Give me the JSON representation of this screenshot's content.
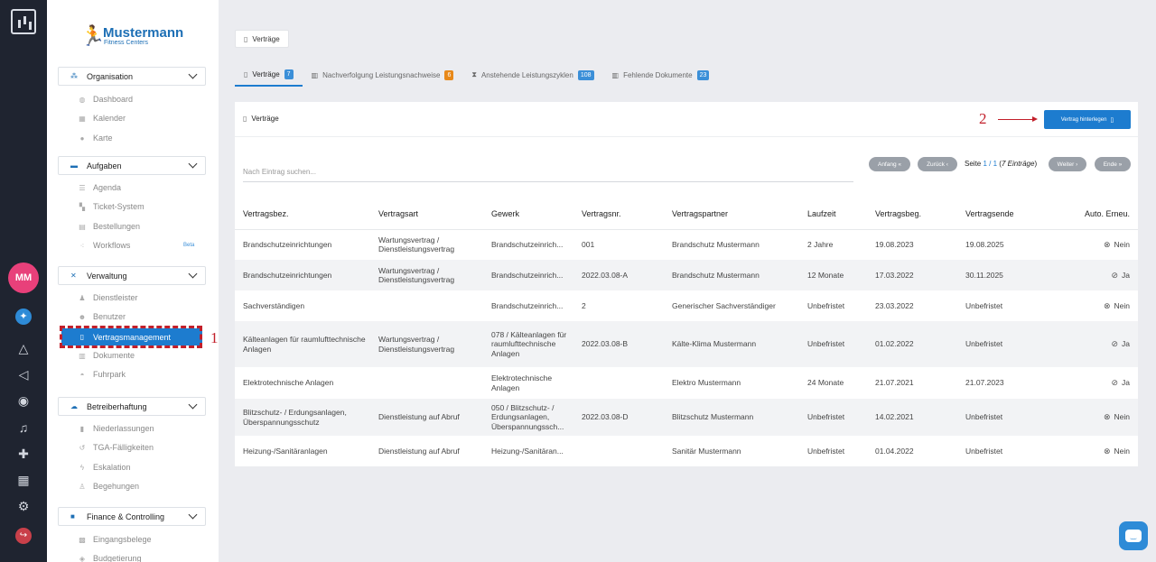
{
  "colors": {
    "accent": "#1d7ccf",
    "rail": "#1f2430",
    "avatar": "#e8407a",
    "annotation": "#c21f2a",
    "badge_orange": "#e8891a",
    "badge_blue": "#3b8fd8"
  },
  "rail": {
    "avatar_initials": "MM",
    "icons": [
      "app-logo-icon",
      "compass-icon",
      "triangle-icon",
      "megaphone-icon",
      "eye-icon",
      "bell-icon",
      "puzzle-icon",
      "store-icon",
      "gear-icon",
      "logout-icon"
    ]
  },
  "brand": {
    "name": "Mustermann",
    "subtitle": "Fitness Centers"
  },
  "sidebar": {
    "sections": [
      {
        "title": "Organisation",
        "items": [
          "Dashboard",
          "Kalender",
          "Karte"
        ]
      },
      {
        "title": "Aufgaben",
        "items": [
          "Agenda",
          "Ticket-System",
          "Bestellungen",
          "Workflows"
        ],
        "beta_label": "Beta"
      },
      {
        "title": "Verwaltung",
        "items": [
          "Dienstleister",
          "Benutzer",
          "Vertragsmanagement",
          "Dokumente",
          "Fuhrpark"
        ],
        "active": "Vertragsmanagement"
      },
      {
        "title": "Betreiberhaftung",
        "items": [
          "Niederlassungen",
          "TGA-Fälligkeiten",
          "Eskalation",
          "Begehungen"
        ]
      },
      {
        "title": "Finance & Controlling",
        "items": [
          "Eingangsbelege",
          "Budgetierung"
        ]
      }
    ]
  },
  "annotations": {
    "marker1": "1",
    "marker2": "2"
  },
  "breadcrumb": {
    "label": "Verträge"
  },
  "tabs": [
    {
      "label": "Verträge",
      "count": "7"
    },
    {
      "label": "Nachverfolgung Leistungsnachweise",
      "count": "6"
    },
    {
      "label": "Anstehende Leistungszyklen",
      "count": "108"
    },
    {
      "label": "Fehlende Dokumente",
      "count": "23"
    }
  ],
  "panel": {
    "title": "Verträge",
    "add_button": "Vertrag hinterlegen",
    "search_placeholder": "Nach Eintrag suchen...",
    "pagination": {
      "first": "Anfang",
      "prev": "Zurück",
      "next": "Weiter",
      "last": "Ende",
      "prefix": "Seite",
      "page": "1",
      "sep": "/",
      "total_pages": "1",
      "entries": "7 Einträge"
    }
  },
  "table": {
    "columns": [
      "Vertragsbez.",
      "Vertragsart",
      "Gewerk",
      "Vertragsnr.",
      "Vertragspartner",
      "Laufzeit",
      "Vertragsbeg.",
      "Vertragsende",
      "Auto. Erneu."
    ],
    "rows": [
      {
        "bez": "Brandschutzeinrichtungen",
        "art": "Wartungsvertrag / Dienstleistungsvertrag",
        "gewerk": "Brandschutzeinrich...",
        "nr": "001",
        "partner": "Brandschutz Mustermann",
        "laufzeit": "2 Jahre",
        "beginn": "19.08.2023",
        "ende": "19.08.2025",
        "auto": "Nein"
      },
      {
        "bez": "Brandschutzeinrichtungen",
        "art": "Wartungsvertrag / Dienstleistungsvertrag",
        "gewerk": "Brandschutzeinrich...",
        "nr": "2022.03.08-A",
        "partner": "Brandschutz Mustermann",
        "laufzeit": "12 Monate",
        "beginn": "17.03.2022",
        "ende": "30.11.2025",
        "auto": "Ja"
      },
      {
        "bez": "Sachverständigen",
        "art": "",
        "gewerk": "Brandschutzeinrich...",
        "nr": "2",
        "partner": "Generischer Sachverständiger",
        "laufzeit": "Unbefristet",
        "beginn": "23.03.2022",
        "ende": "Unbefristet",
        "auto": "Nein"
      },
      {
        "bez": "Kälteanlagen für raumlufttechnische Anlagen",
        "art": "Wartungsvertrag / Dienstleistungsvertrag",
        "gewerk": "078 / Kälteanlagen für raumlufttechnische Anlagen",
        "nr": "2022.03.08-B",
        "partner": "Kälte-Klima Mustermann",
        "laufzeit": "Unbefristet",
        "beginn": "01.02.2022",
        "ende": "Unbefristet",
        "auto": "Ja"
      },
      {
        "bez": "Elektrotechnische Anlagen",
        "art": "",
        "gewerk": "Elektrotechnische Anlagen",
        "nr": "",
        "partner": "Elektro Mustermann",
        "laufzeit": "24 Monate",
        "beginn": "21.07.2021",
        "ende": "21.07.2023",
        "auto": "Ja"
      },
      {
        "bez": "Blitzschutz- / Erdungsanlagen, Überspannungsschutz",
        "art": "Dienstleistung auf Abruf",
        "gewerk": "050 / Blitzschutz- / Erdungsanlagen, Überspannungssch...",
        "nr": "2022.03.08-D",
        "partner": "Blitzschutz Mustermann",
        "laufzeit": "Unbefristet",
        "beginn": "14.02.2021",
        "ende": "Unbefristet",
        "auto": "Nein"
      },
      {
        "bez": "Heizung-/Sanitäranlagen",
        "art": "Dienstleistung auf Abruf",
        "gewerk": "Heizung-/Sanitäran...",
        "nr": "",
        "partner": "Sanitär Mustermann",
        "laufzeit": "Unbefristet",
        "beginn": "01.04.2022",
        "ende": "Unbefristet",
        "auto": "Nein"
      }
    ]
  }
}
